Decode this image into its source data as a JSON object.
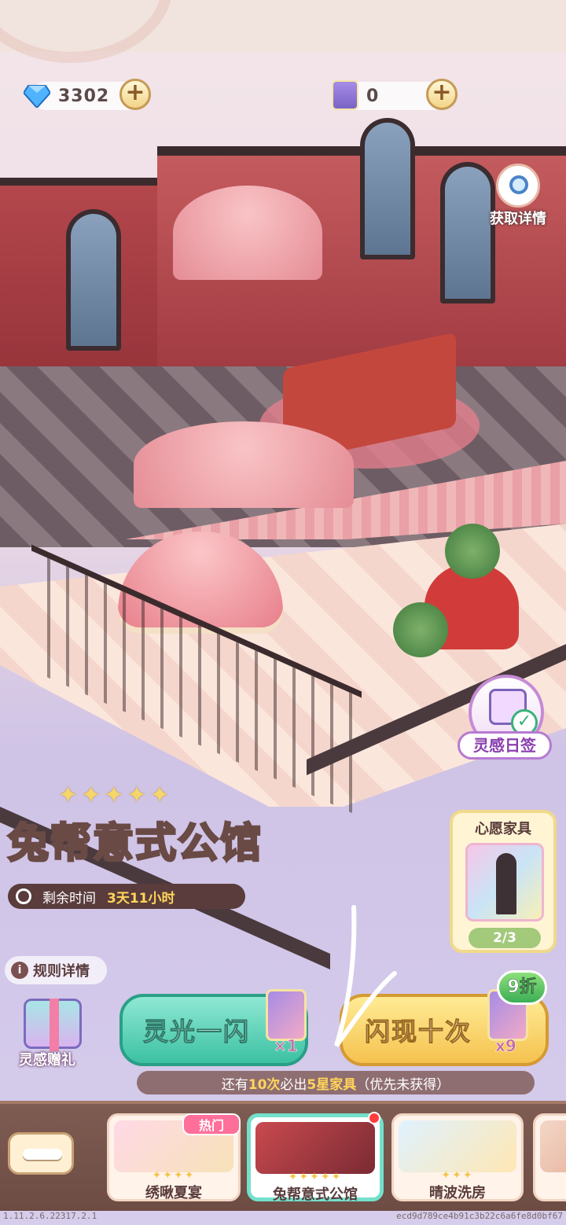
{
  "currency": {
    "gems": "3302",
    "tickets": "0"
  },
  "side": {
    "details_label": "获取详情",
    "checkin_label": "灵感日签"
  },
  "banner": {
    "stars": [
      "✦",
      "✦",
      "✦",
      "✦",
      "✦"
    ],
    "title": "兔帮意式公馆",
    "time_label": "剩余时间",
    "time_value": "3天11小时"
  },
  "wish": {
    "title": "心愿家具",
    "progress": "2/3"
  },
  "rules_label": "规则详情",
  "gift_label": "灵感赠礼",
  "draw": {
    "single_label": "灵光一闪",
    "single_mult": "×1",
    "ten_label": "闪现十次",
    "ten_mult": "x9",
    "discount": "9折",
    "guarantee_pre": "还有",
    "guarantee_num": "10次",
    "guarantee_mid": "必出",
    "guarantee_star": "5星家具",
    "guarantee_post": "（优先未获得）"
  },
  "tabs": [
    {
      "name": "绣啾夏宴",
      "stars": "✦✦✦✦",
      "selected": false
    },
    {
      "name": "兔帮意式公馆",
      "stars": "✦✦✦✦✦",
      "selected": true
    },
    {
      "name": "晴波洗房",
      "stars": "✦✦✦",
      "selected": false
    }
  ],
  "hot_badge": "热门",
  "footer": {
    "version": "1.11.2.6.22317.2.1",
    "hash": "ecd9d789ce4b91c3b22c6a6fe8d0bf67"
  },
  "colors": {
    "teal_button": "#3cc1a2",
    "gold_button": "#f5c24f",
    "accent_pink": "#ff6f9a"
  }
}
